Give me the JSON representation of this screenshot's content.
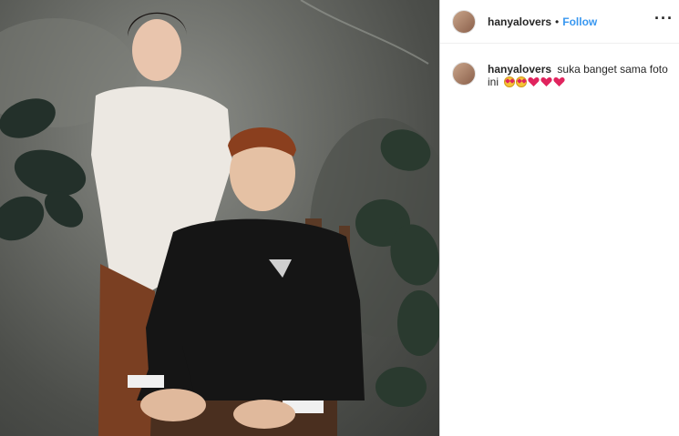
{
  "post": {
    "author": "hanyalovers",
    "separator": "•",
    "follow_label": "Follow",
    "more_label": "···"
  },
  "comments": [
    {
      "username": "hanyalovers",
      "text": "suka banget sama foto ini",
      "emojis": [
        "heart-eyes-emoji",
        "heart-eyes-emoji",
        "red-heart-emoji",
        "red-heart-emoji",
        "red-heart-emoji"
      ]
    }
  ],
  "colors": {
    "follow": "#3897f0",
    "divider": "#dbdbdb",
    "text": "#262626"
  }
}
